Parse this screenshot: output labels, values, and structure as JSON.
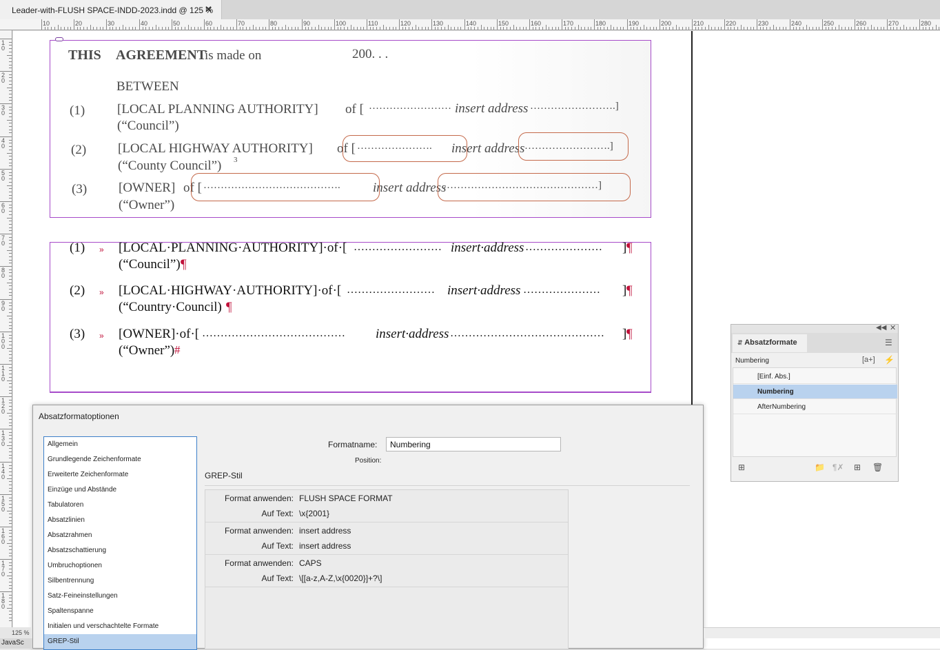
{
  "document_tab": {
    "title": "Leader-with-FLUSH SPACE-INDD-2023.indd @ 125 %",
    "close_glyph": "✕"
  },
  "ruler": {
    "h_labels": [
      "10",
      "20",
      "30",
      "40",
      "50",
      "60",
      "70",
      "80",
      "90",
      "100",
      "110",
      "120",
      "130",
      "140",
      "150",
      "160",
      "170",
      "180",
      "190",
      "200",
      "210",
      "220",
      "230",
      "240",
      "250",
      "260",
      "270",
      "280"
    ],
    "v_labels": [
      "10",
      "20",
      "30",
      "40",
      "50",
      "60",
      "70",
      "80",
      "90",
      "100",
      "110",
      "120",
      "130",
      "140",
      "150",
      "160",
      "170",
      "180"
    ]
  },
  "scan": {
    "title_this": "THIS",
    "title_agreement": "AGREEMENT",
    "title_rest": "is made on",
    "year": "200. . .",
    "between": "BETWEEN",
    "rows": [
      {
        "num": "(1)",
        "party": "[LOCAL PLANNING AUTHORITY]",
        "of": "of [",
        "dots1": "……………………",
        "addr": "insert address",
        "dots2": "…………………….]",
        "short": "(“Council”)"
      },
      {
        "num": "(2)",
        "party": "[LOCAL HIGHWAY AUTHORITY]",
        "of": "of [",
        "dots1": "………………….",
        "addr": "insert address",
        "dots2": "…………………….]",
        "short": "(“County Council”)",
        "footnote": "3"
      },
      {
        "num": "(3)",
        "party": "[OWNER]",
        "of": "of [",
        "dots1": "………………………………….",
        "addr": "insert address",
        "dots2": "………………………………………]",
        "short": "(“Owner”)"
      }
    ]
  },
  "text": {
    "rows": [
      {
        "num": "(1)",
        "arrow": "»",
        "party": "[LOCAL·PLANNING·AUTHORITY]·of·[",
        "dots1": "……………………",
        "addr": "insert·address",
        "dots2": "…………………",
        "close": "]",
        "end": "¶",
        "short": "(“Council”)",
        "short_end": "¶"
      },
      {
        "num": "(2)",
        "arrow": "»",
        "party": "[LOCAL·HIGHWAY·AUTHORITY]·of·[",
        "dots1": "……………………",
        "addr": "insert·address",
        "dots2": "…………………",
        "close": "]",
        "end": "¶",
        "short": "(“Country·Council)",
        "short_end": "¶"
      },
      {
        "num": "(3)",
        "arrow": "»",
        "party": "[OWNER]·of·[",
        "dots1": "…………………………………",
        "addr": "insert·address",
        "dots2": "……………………………………",
        "close": "]",
        "end": "¶",
        "short": "(“Owner”)",
        "short_end": "#"
      }
    ]
  },
  "panel": {
    "tab_label": "Absatzformate",
    "current_style": "Numbering",
    "styles": [
      "[Einf. Abs.]",
      "Numbering",
      "AfterNumbering"
    ],
    "selected_index": 1
  },
  "dialog": {
    "title": "Absatzformatoptionen",
    "sidebar": [
      "Allgemein",
      "Grundlegende Zeichenformate",
      "Erweiterte Zeichenformate",
      "Einzüge und Abstände",
      "Tabulatoren",
      "Absatzlinien",
      "Absatzrahmen",
      "Absatzschattierung",
      "Umbruchoptionen",
      "Silbentrennung",
      "Satz-Feineinstellungen",
      "Spaltenspanne",
      "Initialen und verschachtelte Formate",
      "GREP-Stil"
    ],
    "sidebar_selected": "GREP-Stil",
    "format_name_label": "Formatname:",
    "format_name_value": "Numbering",
    "position_label": "Position:",
    "section_title": "GREP-Stil",
    "grep_styles": [
      {
        "apply_label": "Format anwenden:",
        "apply_value": "FLUSH SPACE FORMAT",
        "text_label": "Auf Text:",
        "text_value": "\\x{2001}"
      },
      {
        "apply_label": "Format anwenden:",
        "apply_value": "insert address",
        "text_label": "Auf Text:",
        "text_value": "insert address"
      },
      {
        "apply_label": "Format anwenden:",
        "apply_value": "CAPS",
        "text_label": "Auf Text:",
        "text_value": "\\[[a-z,A-Z,\\x{0020}]+?\\]"
      }
    ]
  },
  "status": {
    "zoom": "125 %",
    "script_label": "JavaSc"
  },
  "colors": {
    "frame": "#a64ac9",
    "hidden_char": "#c0113a",
    "selection": "#b9d2ee",
    "annotation_circle": "#c4694a"
  }
}
